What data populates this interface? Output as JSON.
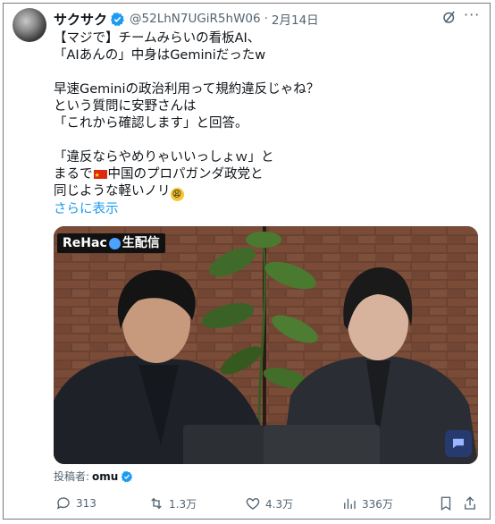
{
  "author": {
    "display_name": "サクサク",
    "handle": "@52LhN7UGiR5hW06",
    "separator": "·",
    "date": "2月14日"
  },
  "tweet": {
    "line1": "【マジで】チームみらいの看板AI、",
    "line2": "「AIあんの」中身はGeminiだったw",
    "line3": "早速Geminiの政治利用って規約違反じゃね？",
    "line4": "という質問に安野さんは",
    "line5": "「これから確認します」と回答。",
    "line6": "「違反ならやめりゃいいっしょｗ」と",
    "line7a": "まるで",
    "line7b": "中国のプロパガンダ政党と",
    "line8": "同じような軽いノリ",
    "show_more": "さらに表示"
  },
  "media": {
    "channel": "ReHac",
    "channel_suffix": "生配信"
  },
  "poster": {
    "label": "投稿者:",
    "name": "omu"
  },
  "actions": {
    "replies": "313",
    "reposts": "1.3万",
    "likes": "4.3万",
    "views": "336万"
  },
  "colors": {
    "accent": "#1d9bf0",
    "secondary_text": "#536471"
  },
  "icons": {
    "grok": "grok-icon",
    "more": "more-icon",
    "reply": "reply-icon",
    "repost": "repost-icon",
    "like": "heart-icon",
    "views": "views-icon",
    "bookmark": "bookmark-icon",
    "share": "share-icon"
  }
}
